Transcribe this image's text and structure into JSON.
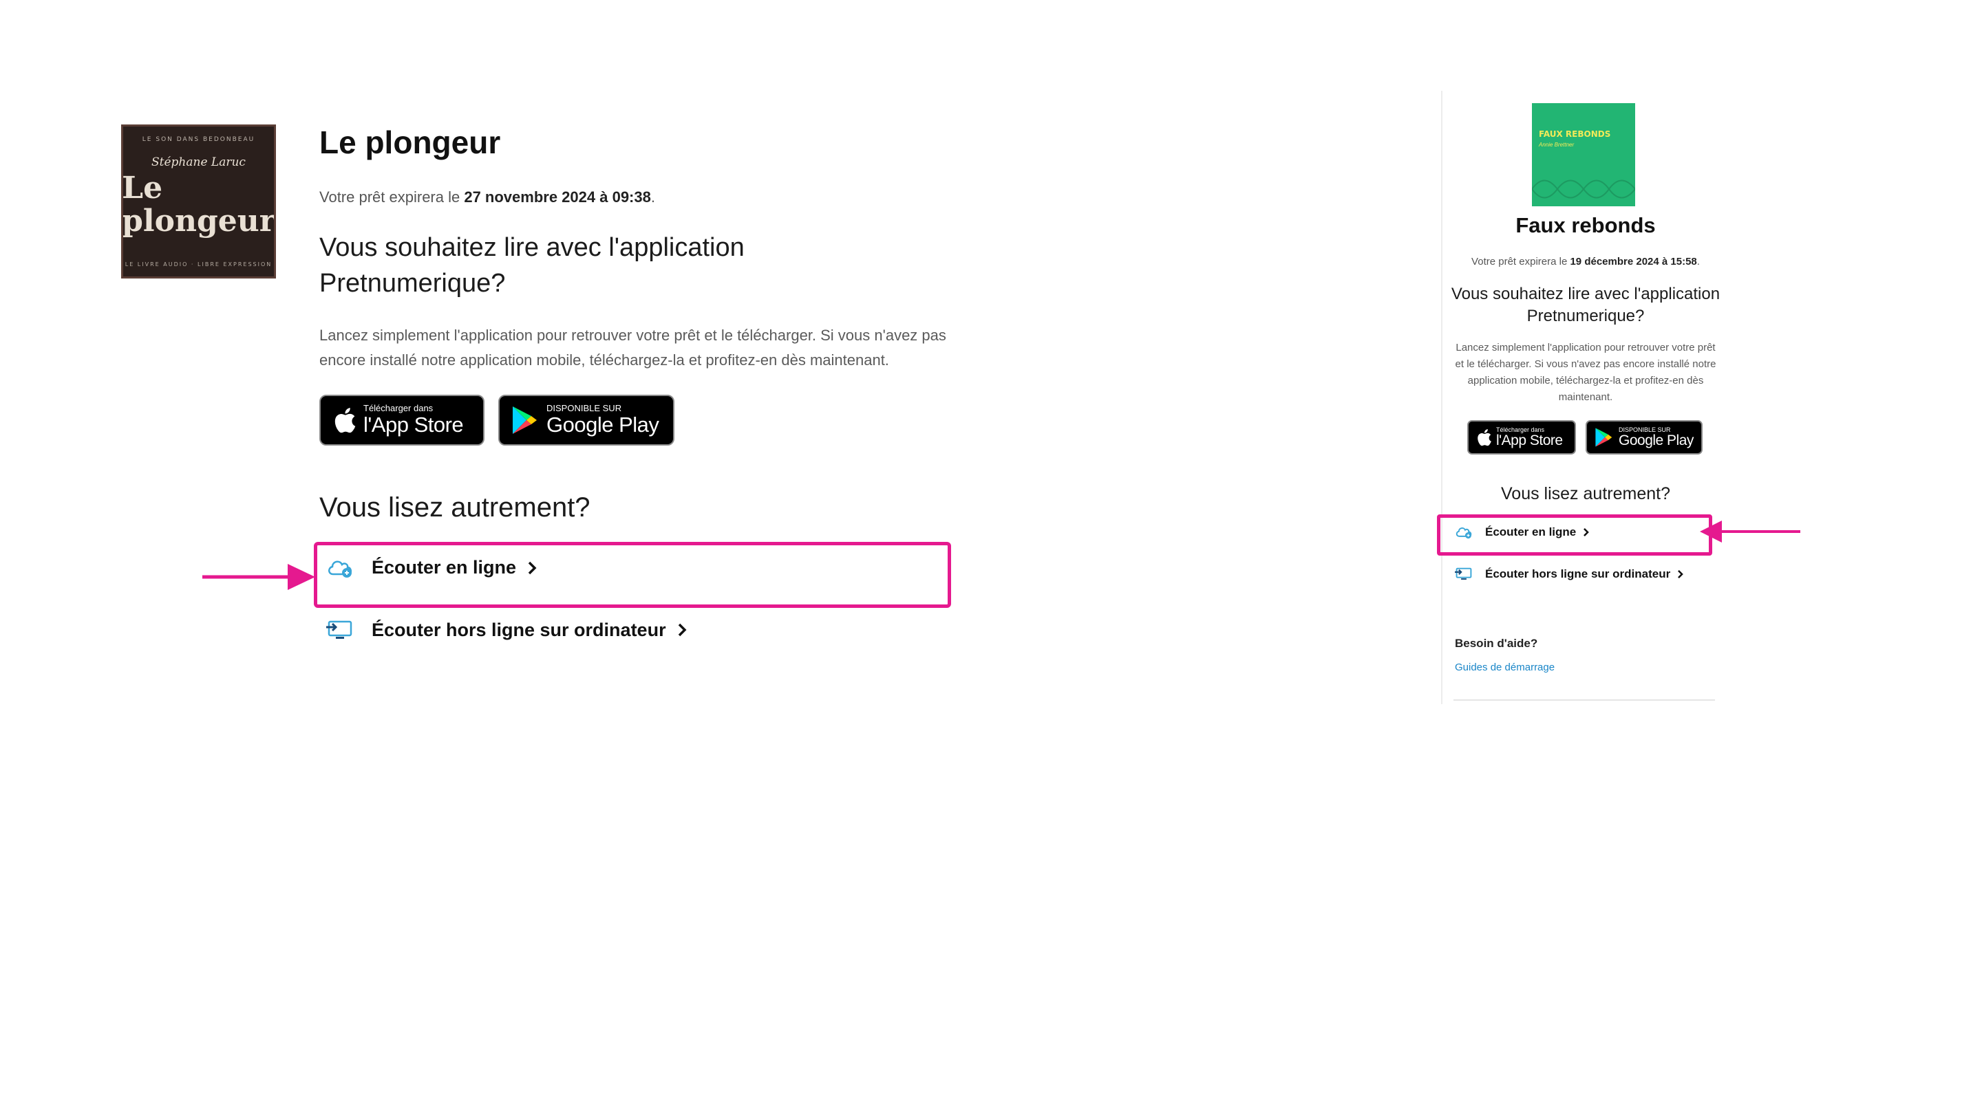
{
  "left_panel": {
    "cover": {
      "top_text": "LE SON DANS BEDONBEAU",
      "author": "Stéphane Laruc",
      "title": "Le plongeur",
      "bottom_text": "LE LIVRE AUDIO · LIBRE EXPRESSION"
    },
    "title": "Le plongeur",
    "expiry_prefix": "Votre prêt expirera le ",
    "expiry_date": "27 novembre 2024 à 09:38",
    "expiry_suffix": ".",
    "question": "Vous souhaitez lire avec l'application Pretnumerique?",
    "description": "Lancez simplement l'application pour retrouver votre prêt et le télécharger. Si vous n'avez pas encore installé notre application mobile, téléchargez-la et profitez-en dès maintenant.",
    "app_store": {
      "small": "Télécharger dans",
      "big": "l'App Store"
    },
    "google_play": {
      "small": "DISPONIBLE SUR",
      "big": "Google Play"
    },
    "other_heading": "Vous lisez autrement?",
    "link_online": "Écouter en ligne",
    "link_offline": "Écouter hors ligne sur ordinateur"
  },
  "right_panel": {
    "cover": {
      "title": "FAUX REBONDS",
      "author": "Annie Brettner"
    },
    "title": "Faux rebonds",
    "expiry_prefix": "Votre prêt expirera le ",
    "expiry_date": "19 décembre 2024 à 15:58",
    "expiry_suffix": ".",
    "question": "Vous souhaitez lire avec l'application Pretnumerique?",
    "description": "Lancez simplement l'application pour retrouver votre prêt et le télécharger. Si vous n'avez pas encore installé notre application mobile, téléchargez-la et profitez-en dès maintenant.",
    "app_store": {
      "small": "Télécharger dans",
      "big": "l'App Store"
    },
    "google_play": {
      "small": "DISPONIBLE SUR",
      "big": "Google Play"
    },
    "other_heading": "Vous lisez autrement?",
    "link_online": "Écouter en ligne",
    "link_offline": "Écouter hors ligne sur ordinateur",
    "help_title": "Besoin d'aide?",
    "help_link": "Guides de démarrage"
  },
  "colors": {
    "highlight": "#e5198f",
    "link_blue": "#1a86c8",
    "cloud_icon": "#3aa6d8",
    "green_cover": "#22b573"
  },
  "icons": [
    "apple-icon",
    "google-play-icon",
    "cloud-listen-icon",
    "computer-download-icon",
    "chevron-right-icon",
    "arrow-right-icon",
    "arrow-left-icon"
  ]
}
